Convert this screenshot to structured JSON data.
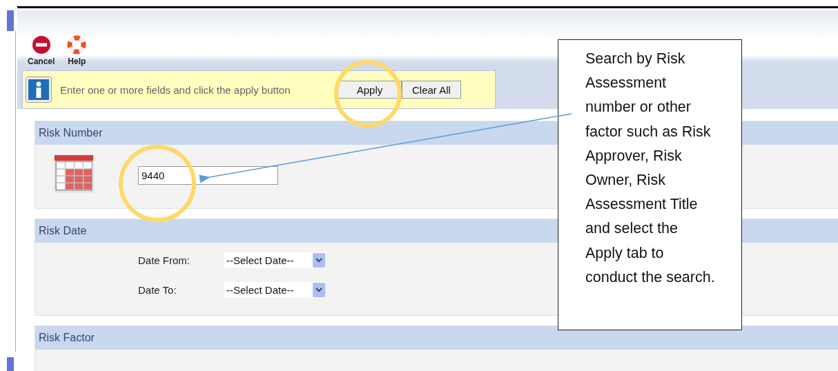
{
  "toolbar": [
    {
      "kind": "cancel",
      "label": "Cancel"
    },
    {
      "kind": "help",
      "label": "Help"
    }
  ],
  "info_bar": {
    "message": "Enter one or more fields and click the apply button",
    "buttons": [
      "Apply",
      "Clear All"
    ]
  },
  "sections": [
    {
      "kind": "number",
      "title": "Risk Number",
      "value": "9440"
    },
    {
      "kind": "date",
      "title": "Risk Date",
      "fields": [
        {
          "label": "Date From:",
          "value": "--Select Date--"
        },
        {
          "label": "Date To:",
          "value": "--Select Date--"
        }
      ]
    },
    {
      "kind": "empty",
      "title": "Risk Factor"
    }
  ],
  "callout": {
    "text": "Search by Risk Assessment number or other factor such as Risk Approver, Risk Owner, Risk Assessment Title and select the Apply tab to conduct the search."
  }
}
